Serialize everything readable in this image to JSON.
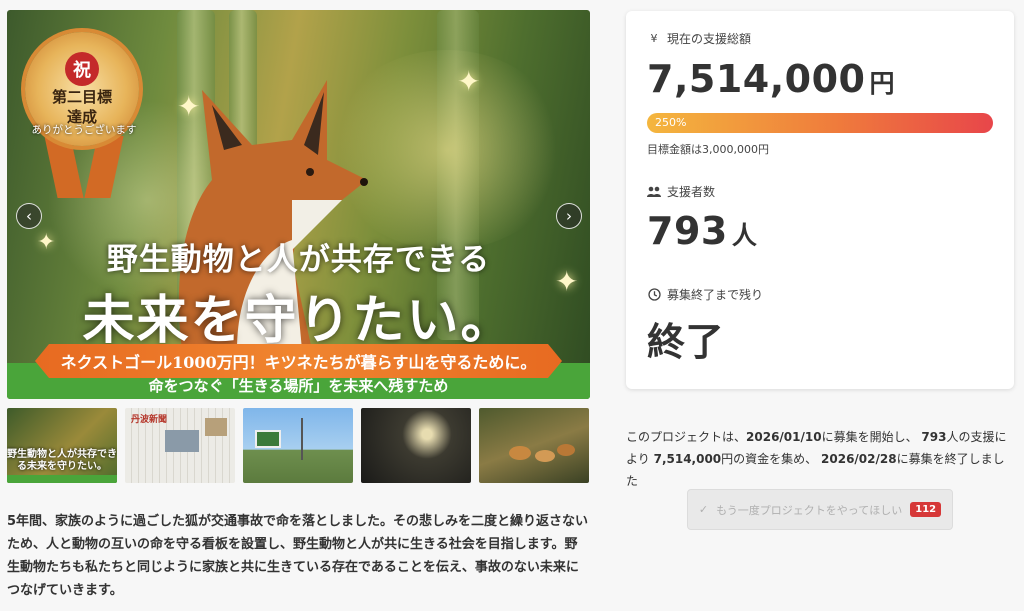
{
  "hero": {
    "badge": {
      "iwai": "祝",
      "goal_line1": "第二目標",
      "goal_line2": "達成",
      "thanks": "ありがとうございます"
    },
    "headline_top": "野生動物と人が共存できる",
    "headline_main": "未来を守りたい。",
    "orange_band": "ネクストゴール1000万円！キツネたちが暮らす山を守るために。",
    "green_band": "命をつなぐ「生きる場所」を未来へ残すため",
    "prev_icon": "chevron-left-icon",
    "next_icon": "chevron-right-icon"
  },
  "thumbnails": [
    {
      "kind": "key-visual",
      "text": "野生動物と人が共存できる未来を守りたい。"
    },
    {
      "kind": "newspaper",
      "text": "丹波新聞"
    },
    {
      "kind": "signboard"
    },
    {
      "kind": "night-road"
    },
    {
      "kind": "foxes"
    }
  ],
  "description": "5年間、家族のように過ごした狐が交通事故で命を落としました。その悲しみを二度と繰り返さないため、人と動物の互いの命を守る看板を設置し、野生動物と人が共に生きる社会を目指します。野生動物たちも私たちと同じように家族と共に生きている存在であることを伝え、事故のない未来につなげていきます。",
  "stats": {
    "total": {
      "label": "現在の支援総額",
      "icon": "yen-icon",
      "value": "7,514,000",
      "unit": "円",
      "progress_percent": 250,
      "progress_text": "250%",
      "goal_text": "目標金額は3,000,000円"
    },
    "supporters": {
      "label": "支援者数",
      "icon": "users-icon",
      "value": "793",
      "unit": "人"
    },
    "remaining": {
      "label": "募集終了まで残り",
      "icon": "clock-icon",
      "value": "終了"
    }
  },
  "summary": {
    "p1": "このプロジェクトは、",
    "start_date": "2026/01/10",
    "p2": "に募集を開始し、",
    "supporters": "793",
    "p3": "人の支援により",
    "amount": "7,514,000",
    "p4": "円の資金を集め、",
    "end_date": "2026/02/28",
    "p5": "に募集を終了しました"
  },
  "again_button": {
    "icon": "check-icon",
    "label": "もう一度プロジェクトをやってほしい",
    "count": "112"
  },
  "colors": {
    "progress_start": "#f4b63e",
    "progress_end": "#e8464a",
    "badge_red": "#d63838",
    "band_orange": "#e76a21",
    "band_green": "#4aa53a"
  }
}
